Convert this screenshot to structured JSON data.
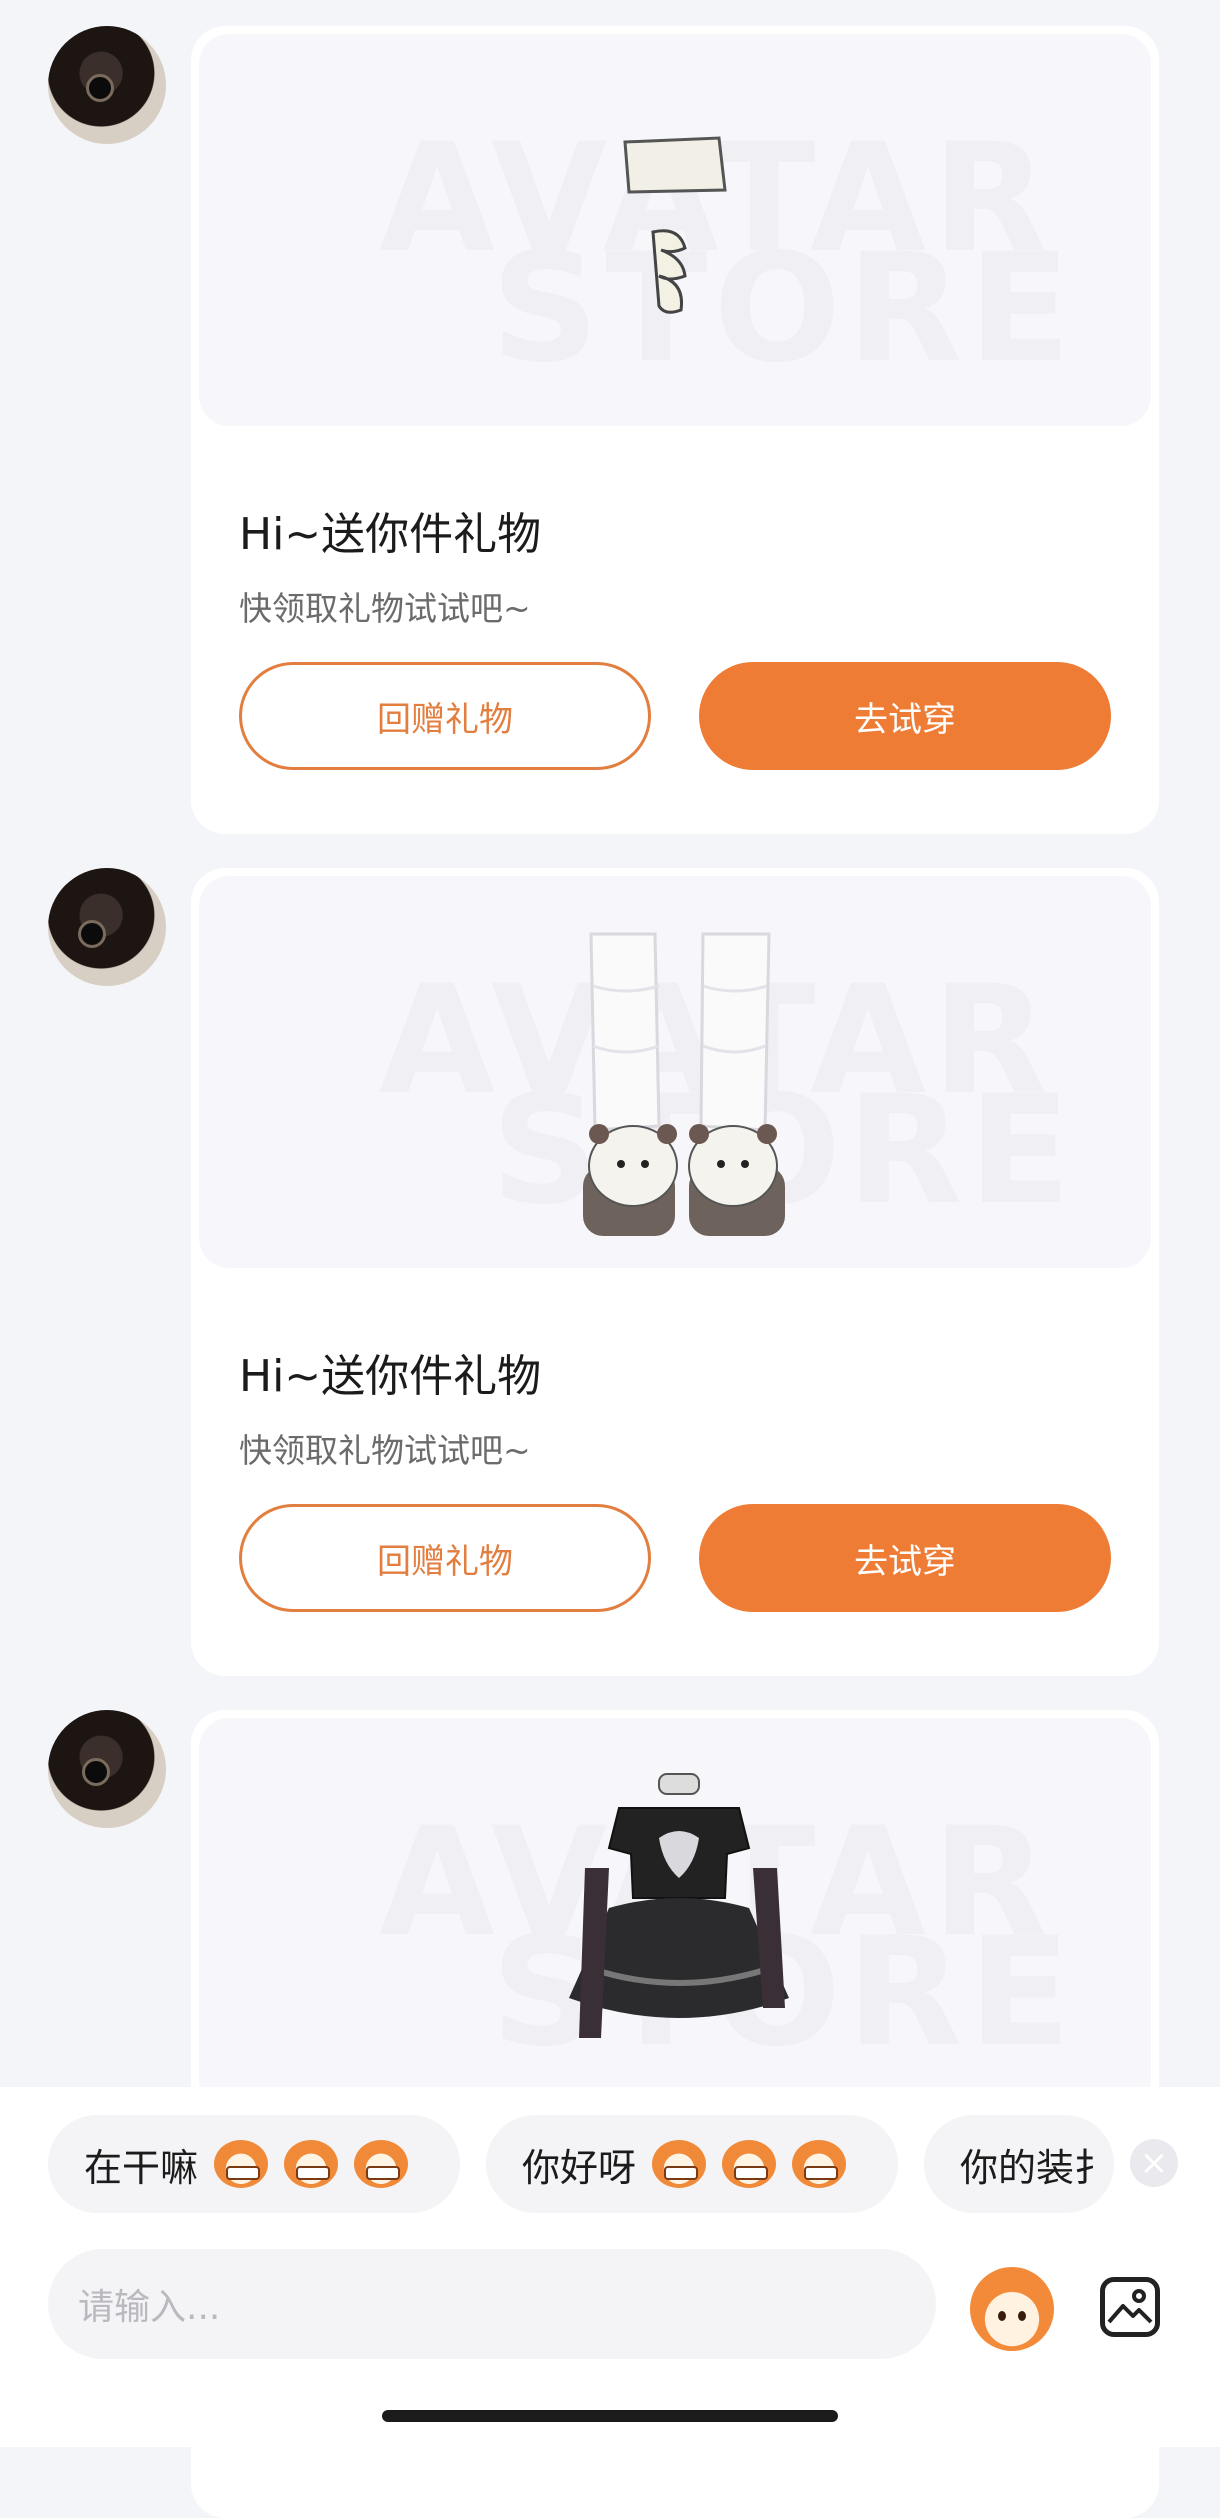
{
  "messages": [
    {
      "title": "Hi~送你件礼物",
      "subtitle": "快领取礼物试试吧~",
      "return_label": "回赠礼物",
      "try_label": "去试穿",
      "watermark_1": "AVATAR",
      "watermark_2": "STORE",
      "item_icon": "shorts-and-socks-icon"
    },
    {
      "title": "Hi~送你件礼物",
      "subtitle": "快领取礼物试试吧~",
      "return_label": "回赠礼物",
      "try_label": "去试穿",
      "watermark_1": "AVATAR",
      "watermark_2": "STORE",
      "item_icon": "leg-warmers-bear-shoes-icon"
    },
    {
      "watermark_1": "AVATAR",
      "watermark_2": "STORE",
      "item_icon": "black-lace-outfit-icon"
    }
  ],
  "quick_replies": [
    {
      "label": "在干嘛"
    },
    {
      "label": "你好呀"
    },
    {
      "label": "你的装扌"
    }
  ],
  "composer": {
    "placeholder": "请输入..."
  },
  "colors": {
    "accent": "#ef7c35",
    "background": "#f4f5f9"
  }
}
